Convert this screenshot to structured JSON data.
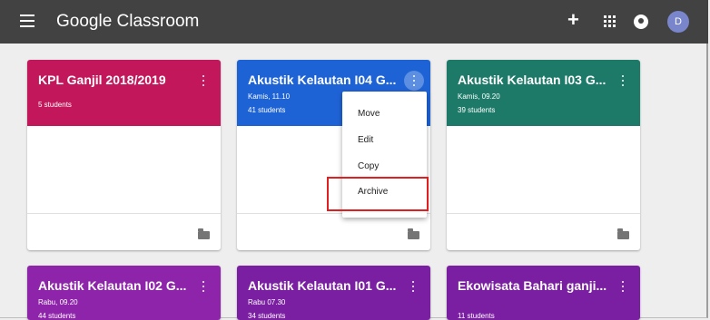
{
  "app": {
    "title": "Google Classroom",
    "avatar_letter": "D",
    "icons": [
      "menu-icon",
      "plus-icon",
      "apps-grid-icon",
      "notification-icon"
    ]
  },
  "colors": {
    "topbar": "#424242",
    "pink": "#c2185b",
    "blue": "#1e63d6",
    "teal": "#1d7a68",
    "purple": "#7b1fa2",
    "highlight": "#e02020"
  },
  "cards": [
    {
      "title": "KPL Ganjil 2018/2019",
      "subtitle": "",
      "students": "5 students"
    },
    {
      "title": "Akustik Kelautan I04 G...",
      "subtitle": "Kamis, 11.10",
      "students": "41 students"
    },
    {
      "title": "Akustik Kelautan I03 G...",
      "subtitle": "Kamis, 09.20",
      "students": "39 students"
    },
    {
      "title": "Akustik Kelautan I02 G...",
      "subtitle": "Rabu, 09.20",
      "students": "44 students"
    },
    {
      "title": "Akustik Kelautan I01 G...",
      "subtitle": "Rabu 07.30",
      "students": "34 students"
    },
    {
      "title": "Ekowisata Bahari ganji...",
      "subtitle": "",
      "students": "11 students"
    }
  ],
  "menu": {
    "items": [
      "Move",
      "Edit",
      "Copy",
      "Archive"
    ]
  }
}
